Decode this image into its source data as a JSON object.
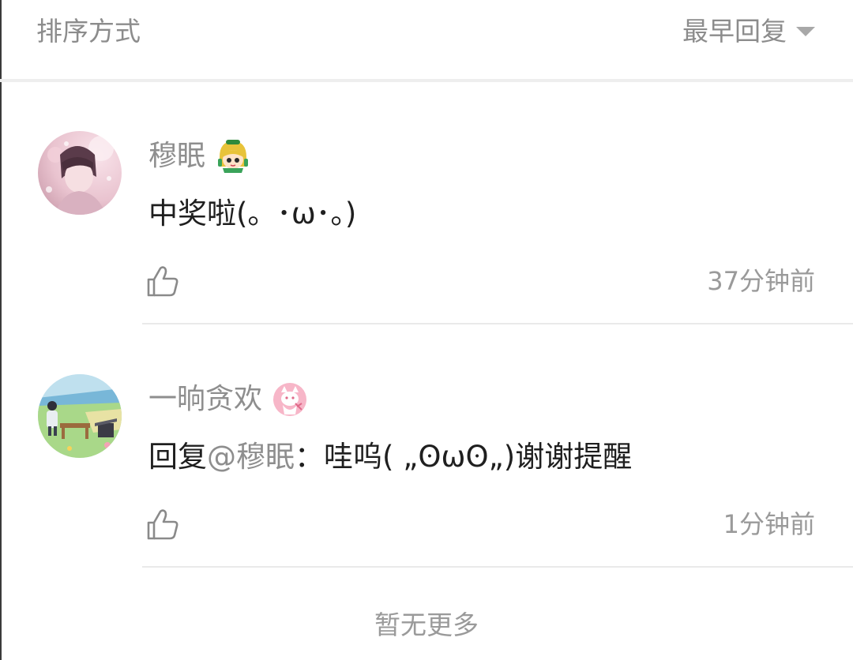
{
  "sort": {
    "label": "排序方式",
    "selected": "最早回复"
  },
  "comments": [
    {
      "username": "穆眠",
      "badge_icon": "cartoon-girl-badge-icon",
      "content": "中奖啦(。･ω･。)",
      "timestamp": "37分钟前",
      "like_icon": "thumbs-up-icon"
    },
    {
      "username": "一晌贪欢",
      "badge_icon": "pink-cat-badge-icon",
      "reply_prefix": "回复",
      "mention": "@穆眠",
      "content": "：哇呜( „ʘωʘ„)谢谢提醒",
      "timestamp": "1分钟前",
      "like_icon": "thumbs-up-icon"
    }
  ],
  "footer": {
    "no_more": "暂无更多"
  },
  "colors": {
    "muted_text": "#8e8e8e",
    "primary_text": "#1f1f1f",
    "divider": "#eaeaea"
  }
}
